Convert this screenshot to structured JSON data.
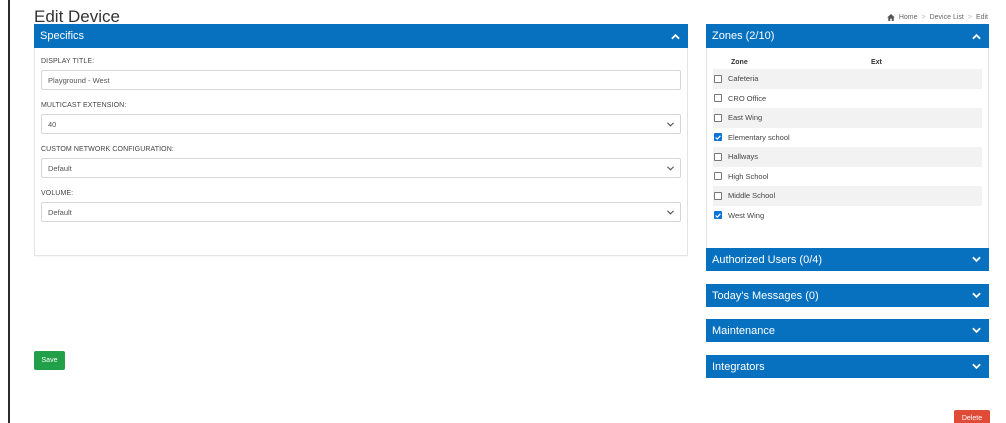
{
  "page": {
    "title": "Edit Device"
  },
  "breadcrumb": {
    "home": "Home",
    "device_list": "Device List",
    "current": "Edit",
    "separator": ">"
  },
  "specifics": {
    "header": "Specifics",
    "fields": {
      "display_title": {
        "label": "DISPLAY TITLE:",
        "value": "Playground - West"
      },
      "multicast_extension": {
        "label": "MULTICAST EXTENSION:",
        "value": "40"
      },
      "custom_network": {
        "label": "CUSTOM NETWORK CONFIGURATION:",
        "value": "Default"
      },
      "volume": {
        "label": "VOLUME:",
        "value": "Default"
      }
    }
  },
  "zones": {
    "header": "Zones (2/10)",
    "col_zone": "Zone",
    "col_ext": "Ext",
    "rows": [
      {
        "name": "Cafeteria",
        "checked": false
      },
      {
        "name": "CRO Office",
        "checked": false
      },
      {
        "name": "East Wing",
        "checked": false
      },
      {
        "name": "Elementary school",
        "checked": true
      },
      {
        "name": "Hallways",
        "checked": false
      },
      {
        "name": "High School",
        "checked": false
      },
      {
        "name": "Middle School",
        "checked": false
      },
      {
        "name": "West Wing",
        "checked": true
      }
    ]
  },
  "panels": {
    "authorized_users": "Authorized Users (0/4)",
    "todays_messages": "Today's Messages (0)",
    "maintenance": "Maintenance",
    "integrators": "Integrators"
  },
  "buttons": {
    "save": "Save",
    "delete": "Delete"
  },
  "colors": {
    "primary": "#0771bf",
    "success": "#22a049",
    "danger": "#df4b37",
    "checkbox": "#0b74d8"
  }
}
